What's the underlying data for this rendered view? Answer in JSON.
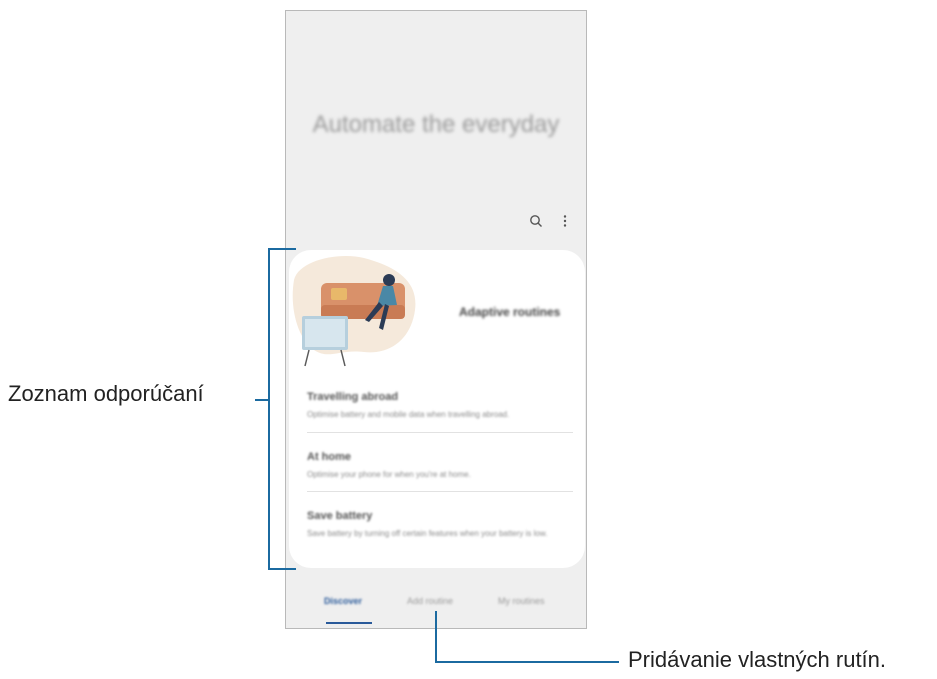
{
  "hero": {
    "title": "Automate the everyday"
  },
  "card": {
    "header": "Adaptive routines",
    "items": [
      {
        "title": "Travelling abroad",
        "desc": "Optimise battery and mobile data when travelling abroad."
      },
      {
        "title": "At home",
        "desc": "Optimise your phone for when you're at home."
      },
      {
        "title": "Save battery",
        "desc": "Save battery by turning off certain features when your battery is low."
      }
    ]
  },
  "tabs": {
    "discover": "Discover",
    "add": "Add routine",
    "my": "My routines"
  },
  "icons": {
    "search": "search-icon",
    "more": "more-options-icon"
  },
  "callouts": {
    "list": "Zoznam odporúčaní",
    "add": "Pridávanie vlastných rutín."
  },
  "colors": {
    "accent": "#1b6aa0",
    "tab_active": "#2a5a9a",
    "screen_bg": "#efefef"
  }
}
